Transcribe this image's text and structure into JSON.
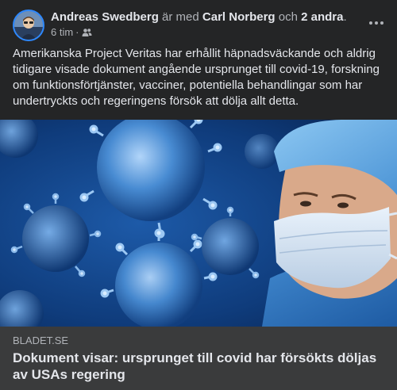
{
  "post": {
    "author": "Andreas Swedberg",
    "with_text": "är med",
    "tagged_person": "Carl Norberg",
    "and_text": "och",
    "others": "2 andra",
    "period": ".",
    "time": "6 tim",
    "audience_icon": "friends-icon",
    "menu_icon": "more-options-icon",
    "text": "Amerikanska Project Veritas har erhållit häpnadsväckande och aldrig tidigare visade dokument angående ursprunget till covid-19, forskning om funktionsförtjänster, vacciner, potentiella behandlingar som har undertryckts och regeringens försök att dölja allt detta."
  },
  "link_preview": {
    "domain": "BLADET.SE",
    "title": "Dokument visar: ursprunget till covid har försökts döljas av USAs regering"
  }
}
